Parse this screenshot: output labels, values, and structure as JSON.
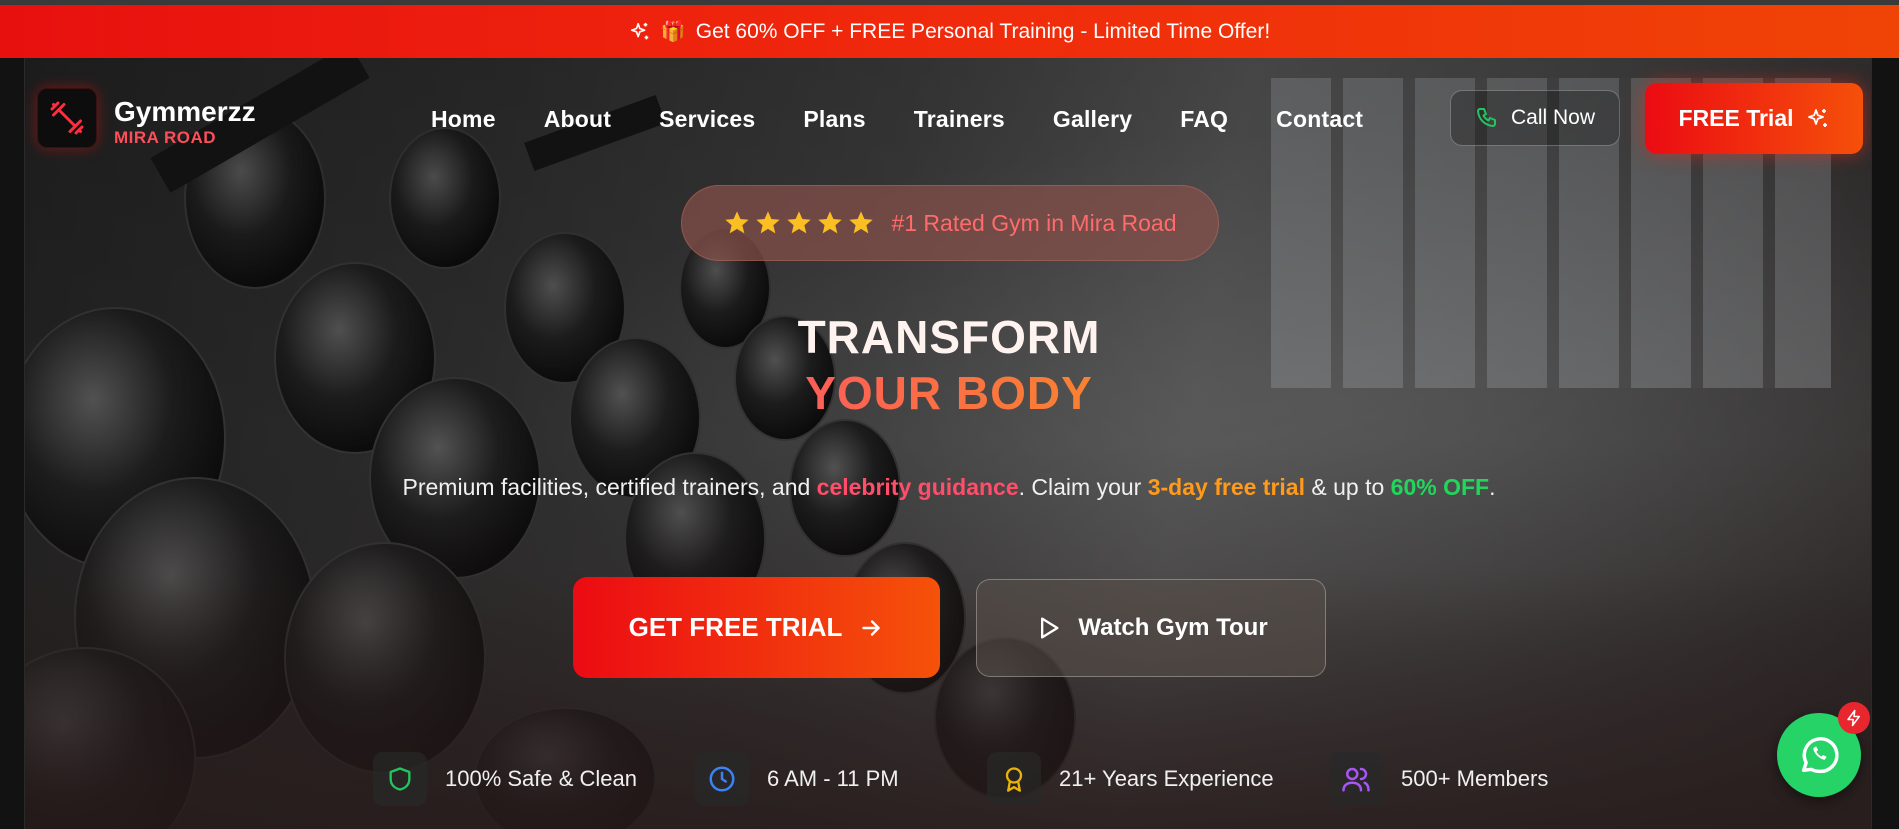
{
  "promo": {
    "text": "Get 60% OFF + FREE Personal Training - Limited Time Offer!",
    "gift_emoji": "🎁",
    "icon": "sparkles-icon"
  },
  "brand": {
    "name": "Gymmerzz",
    "location": "MIRA ROAD",
    "icon": "dumbbell-icon"
  },
  "nav": {
    "items": [
      "Home",
      "About",
      "Services",
      "Plans",
      "Trainers",
      "Gallery",
      "FAQ",
      "Contact"
    ]
  },
  "header_actions": {
    "call_label": "Call Now",
    "trial_label": "FREE Trial"
  },
  "rating": {
    "stars": 5,
    "text": "#1 Rated Gym in Mira Road"
  },
  "hero": {
    "headline_line1": "TRANSFORM",
    "headline_line2": "YOUR BODY",
    "sub_part1": "Premium facilities, certified trainers, and ",
    "sub_hl1": "celebrity guidance",
    "sub_part2": ". Claim your ",
    "sub_hl2": "3-day free trial",
    "sub_part3": " & up to ",
    "sub_hl3": "60% OFF",
    "sub_part4": "."
  },
  "cta": {
    "primary_label": "GET FREE TRIAL",
    "secondary_label": "Watch Gym Tour"
  },
  "features": [
    {
      "label": "100% Safe & Clean",
      "icon": "shield-icon",
      "color": "#22c55e"
    },
    {
      "label": "6 AM - 11 PM",
      "icon": "clock-icon",
      "color": "#3b82f6"
    },
    {
      "label": "21+ Years Experience",
      "icon": "award-icon",
      "color": "#eab308"
    },
    {
      "label": "500+ Members",
      "icon": "users-icon",
      "color": "#a855f7"
    }
  ],
  "colors": {
    "accent_red": "#ec0b13",
    "accent_orange": "#f5500a",
    "whatsapp_green": "#25d366"
  }
}
